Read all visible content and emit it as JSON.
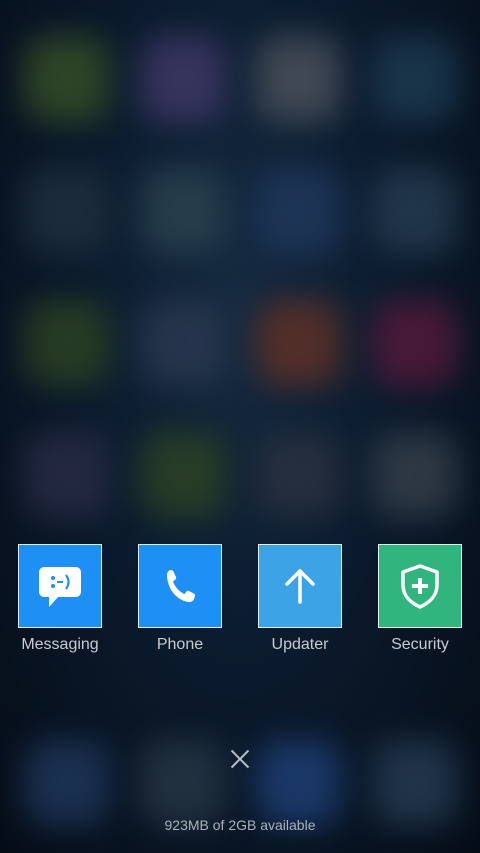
{
  "recent_apps": [
    {
      "label": "Messaging",
      "icon": "message-bubble-icon",
      "color": "#1e8ff5"
    },
    {
      "label": "Phone",
      "icon": "phone-icon",
      "color": "#1e8ff5"
    },
    {
      "label": "Updater",
      "icon": "arrow-up-icon",
      "color": "#3ba3e6"
    },
    {
      "label": "Security",
      "icon": "shield-plus-icon",
      "color": "#2fb57d"
    }
  ],
  "close_icon": "close-icon",
  "memory_text": "923MB of 2GB available"
}
